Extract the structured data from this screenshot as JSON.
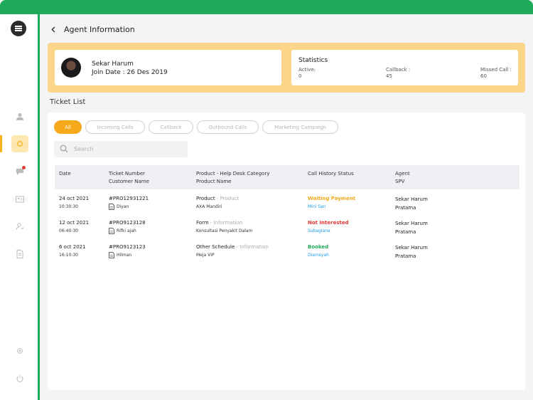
{
  "header": {
    "title": "Agent Information"
  },
  "agent": {
    "name": "Sekar Harum",
    "join_date": "Join Date : 26 Des 2019"
  },
  "statistics": {
    "title": "Statistics",
    "items": [
      {
        "label": "Active:",
        "value": "0"
      },
      {
        "label": "Callback :",
        "value": "45"
      },
      {
        "label": "Missed Call :",
        "value": "60"
      }
    ]
  },
  "ticket_list": {
    "title": "Ticket List",
    "filters": [
      "All",
      "Incoming Calls",
      "Callback",
      "Outbound Calls",
      "Marketing Campaign"
    ],
    "active_filter": "All",
    "search_placeholder": "Search",
    "columns": [
      {
        "line1": "Date",
        "line2": ""
      },
      {
        "line1": "Ticket Number",
        "line2": "Customer Name"
      },
      {
        "line1": "Product - Help Desk Category",
        "line2": "Product Name"
      },
      {
        "line1": "Call History Status",
        "line2": ""
      },
      {
        "line1": "Agent",
        "line2": "SPV"
      }
    ],
    "rows": [
      {
        "date": "24 oct 2021",
        "time": "10:30:30",
        "ticket": "#PRO12931221",
        "customer": "Diyan",
        "product": "Product",
        "separator": " - ",
        "category": "Product",
        "product_name": "AXA Mandiri",
        "status": "Waiting Payment",
        "status_color": "#f5a91b",
        "status_person": "Mini San",
        "status_person_color": "#1e9be9",
        "agent": "Sekar Harum",
        "spv": "Pratama"
      },
      {
        "date": "12 oct 2021",
        "time": "06:40:30",
        "ticket": "#PRO9123128",
        "customer": "Rifki ajah",
        "product": "Form",
        "separator": " - ",
        "category": "Information",
        "product_name": "Konsultasi Penyakit Dalam",
        "status": "Not Interested",
        "status_color": "#e53935",
        "status_person": "Subagiana",
        "status_person_color": "#1e9be9",
        "agent": "Sekar Harum",
        "spv": "Pratama"
      },
      {
        "date": "6 oct 2021",
        "time": "16:10:30",
        "ticket": "#PRO9123123",
        "customer": "Hilman",
        "product": "Other Schedule",
        "separator": " - ",
        "category": "Information",
        "product_name": "Meja VIP",
        "status": "Booked",
        "status_color": "#1faa59",
        "status_person": "Diamsyah",
        "status_person_color": "#1e9be9",
        "agent": "Sekar Harum",
        "spv": "Pratama"
      }
    ]
  },
  "colors": {
    "brand_green": "#1faa59",
    "accent_orange": "#f5a91b",
    "panel_yellow": "#fad58a"
  },
  "sidebar_icons": [
    "logo-icon",
    "user-icon",
    "dashboard-icon",
    "chat-icon",
    "contact-card-icon",
    "agent-icon",
    "report-icon",
    "settings-icon",
    "power-icon"
  ]
}
